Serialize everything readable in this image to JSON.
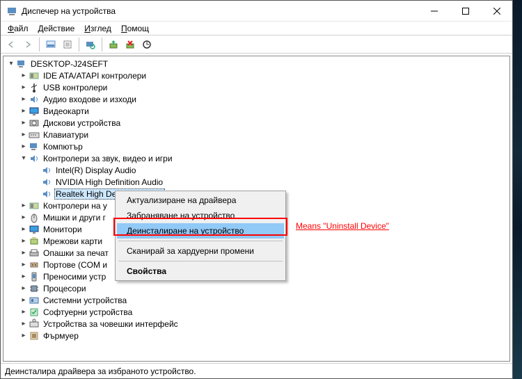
{
  "window": {
    "title": "Диспечер на устройства"
  },
  "menubar": {
    "file": "Файл",
    "action": "Действие",
    "view": "Изглед",
    "help": "Помощ"
  },
  "toolbar_icons": {
    "back": "back-icon",
    "forward": "forward-icon",
    "computer": "computer-icon",
    "properties": "properties-icon",
    "scan": "scan-icon",
    "enable": "enable-icon",
    "uninstall": "uninstall-icon",
    "update": "update-icon"
  },
  "tree": {
    "root": "DESKTOP-J24SEFT",
    "nodes": [
      {
        "label": "IDE ATA/ATAPI контролери",
        "icon": "ide-icon",
        "expander": "right"
      },
      {
        "label": "USB контролери",
        "icon": "usb-icon",
        "expander": "right"
      },
      {
        "label": "Аудио входове и изходи",
        "icon": "audio-io-icon",
        "expander": "right"
      },
      {
        "label": "Видеокарти",
        "icon": "display-adapter-icon",
        "expander": "right"
      },
      {
        "label": "Дискови устройства",
        "icon": "disk-icon",
        "expander": "right"
      },
      {
        "label": "Клавиатури",
        "icon": "keyboard-icon",
        "expander": "right"
      },
      {
        "label": "Компютър",
        "icon": "computer-icon",
        "expander": "right"
      },
      {
        "label": "Контролери за звук, видео и игри",
        "icon": "sound-icon",
        "expander": "down",
        "children": [
          {
            "label": "Intel(R) Display Audio",
            "icon": "sound-icon"
          },
          {
            "label": "NVIDIA High Definition Audio",
            "icon": "sound-icon"
          },
          {
            "label": "Realtek High Definition Audio",
            "icon": "sound-icon",
            "selected": true
          }
        ]
      },
      {
        "label": "Контролери на у",
        "icon": "storage-ctrl-icon",
        "expander": "right"
      },
      {
        "label": "Мишки и други г",
        "icon": "mouse-icon",
        "expander": "right"
      },
      {
        "label": "Монитори",
        "icon": "monitor-icon",
        "expander": "right"
      },
      {
        "label": "Мрежови карти",
        "icon": "network-icon",
        "expander": "right"
      },
      {
        "label": "Опашки за печат",
        "icon": "print-queue-icon",
        "expander": "right"
      },
      {
        "label": "Портове (COM и",
        "icon": "ports-icon",
        "expander": "right"
      },
      {
        "label": "Преносими устр",
        "icon": "portable-icon",
        "expander": "right"
      },
      {
        "label": "Процесори",
        "icon": "cpu-icon",
        "expander": "right"
      },
      {
        "label": "Системни устройства",
        "icon": "system-device-icon",
        "expander": "right"
      },
      {
        "label": "Софтуерни устройства",
        "icon": "software-device-icon",
        "expander": "right"
      },
      {
        "label": "Устройства за човешки интерфейс",
        "icon": "hid-icon",
        "expander": "right"
      },
      {
        "label": "Фърмуер",
        "icon": "firmware-icon",
        "expander": "right"
      }
    ]
  },
  "context_menu": {
    "items": [
      {
        "label": "Актуализиране на драйвера"
      },
      {
        "label": "Забраняване на устройство"
      },
      {
        "label": "Деинсталиране на устройство",
        "highlight": true
      },
      {
        "sep": true
      },
      {
        "label": "Сканирай за хардуерни промени"
      },
      {
        "sep": true
      },
      {
        "label": "Свойства",
        "bold": true
      }
    ]
  },
  "annotation": {
    "text": "Means \"Uninstall Device\""
  },
  "statusbar": {
    "text": "Деинсталира драйвера за избраното устройство."
  }
}
